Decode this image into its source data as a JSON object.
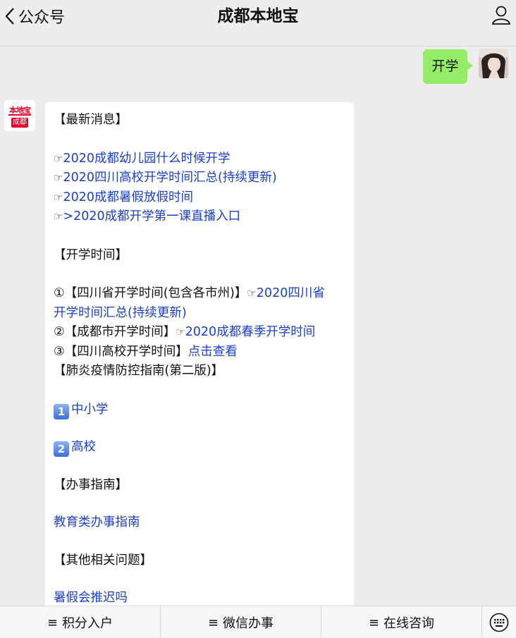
{
  "header": {
    "back_label": "公众号",
    "title": "成都本地宝"
  },
  "user_message": {
    "text": "开学"
  },
  "bot_avatar": {
    "logo_top": "本地宝",
    "logo_bottom": "成都"
  },
  "bot_message": {
    "section_latest": "【最新消息】",
    "latest_links": [
      "2020成都幼儿园什么时候开学",
      "2020四川高校开学时间汇总(持续更新)",
      "2020成都暑假放假时间",
      ">2020成都开学第一课直播入口"
    ],
    "section_time": "【开学时间】",
    "item1_prefix": "①【四川省开学时间(包含各市州)】",
    "item1_link_a": "2020四川省",
    "item1_link_b": "开学时间汇总(持续更新)",
    "item2_prefix": "②【成都市开学时间】",
    "item2_link": "2020成都春季开学时间",
    "item3_prefix": "③【四川高校开学时间】",
    "item3_link": "点击查看",
    "section_epidemic": "【肺炎疫情防控指南(第二版)】",
    "key1": "1",
    "key1_link": "中小学",
    "key2": "2",
    "key2_link": "高校",
    "section_affairs": "【办事指南】",
    "affairs_link": "教育类办事指南",
    "section_other": "【其他相关问题】",
    "other_link": "暑假会推迟吗"
  },
  "bottom_menu": {
    "items": [
      "积分入户",
      "微信办事",
      "在线咨询"
    ]
  }
}
